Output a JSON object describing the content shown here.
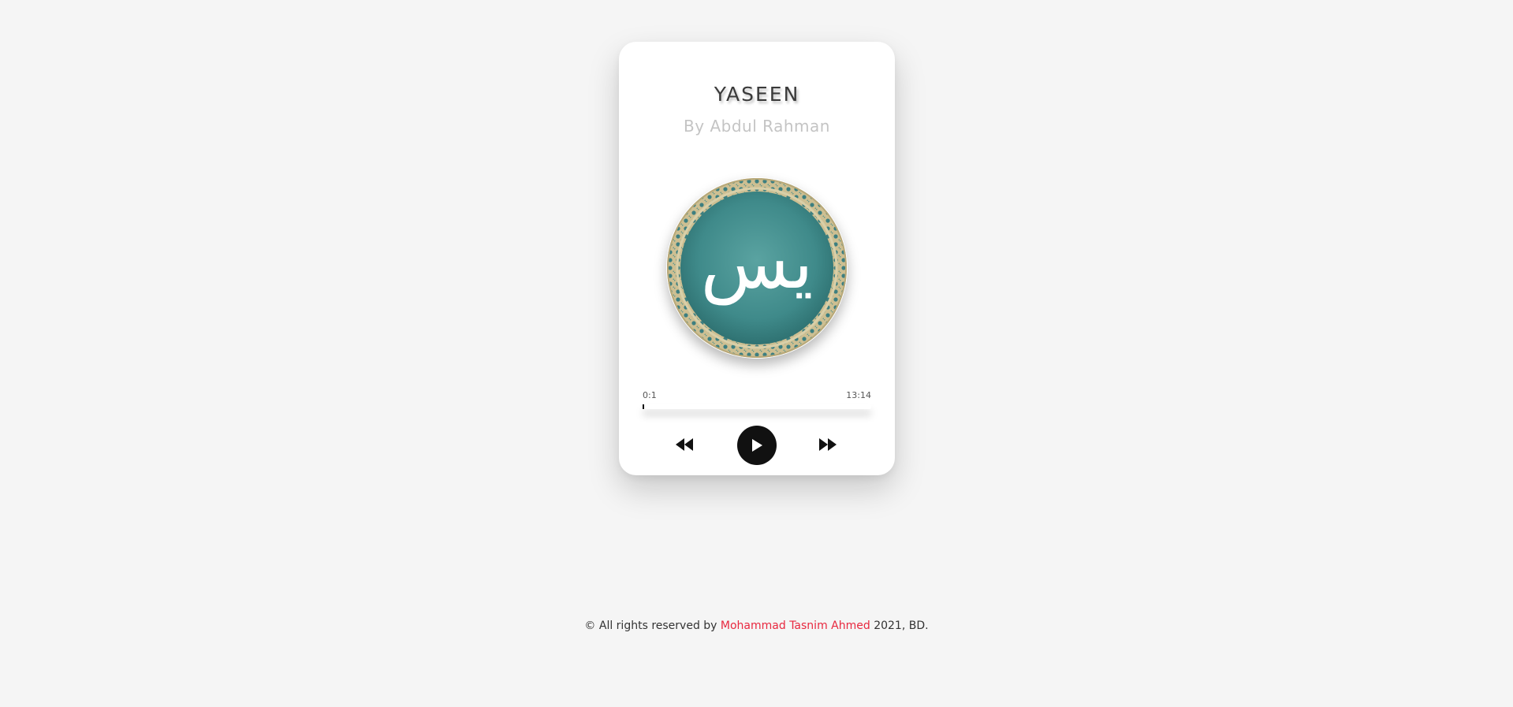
{
  "track": {
    "title": "YASEEN",
    "artist": "By Abdul Rahman",
    "cover_glyph": "يس"
  },
  "playback": {
    "current_time": "0:1",
    "total_time": "13:14",
    "progress": 0.003
  },
  "controls": {
    "prev_icon": "rewind-icon",
    "play_icon": "play-icon",
    "next_icon": "fast-forward-icon"
  },
  "footer": {
    "prefix": "© All rights reserved by ",
    "author": "Mohammad Tasnim Ahmed",
    "suffix": " 2021, BD."
  },
  "colors": {
    "page_bg": "#f5f5f5",
    "card_bg": "#ffffff",
    "cover_teal": "#3f8a8a",
    "author_red": "#e8283f",
    "control_dark": "#111111"
  }
}
